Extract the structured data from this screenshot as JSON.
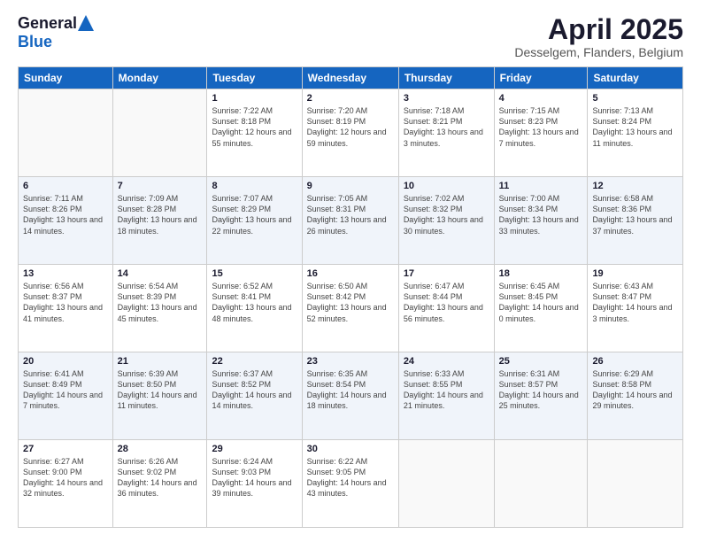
{
  "logo": {
    "general": "General",
    "blue": "Blue"
  },
  "header": {
    "month_year": "April 2025",
    "location": "Desselgem, Flanders, Belgium"
  },
  "weekdays": [
    "Sunday",
    "Monday",
    "Tuesday",
    "Wednesday",
    "Thursday",
    "Friday",
    "Saturday"
  ],
  "weeks": [
    [
      {
        "day": "",
        "info": ""
      },
      {
        "day": "",
        "info": ""
      },
      {
        "day": "1",
        "info": "Sunrise: 7:22 AM\nSunset: 8:18 PM\nDaylight: 12 hours and 55 minutes."
      },
      {
        "day": "2",
        "info": "Sunrise: 7:20 AM\nSunset: 8:19 PM\nDaylight: 12 hours and 59 minutes."
      },
      {
        "day": "3",
        "info": "Sunrise: 7:18 AM\nSunset: 8:21 PM\nDaylight: 13 hours and 3 minutes."
      },
      {
        "day": "4",
        "info": "Sunrise: 7:15 AM\nSunset: 8:23 PM\nDaylight: 13 hours and 7 minutes."
      },
      {
        "day": "5",
        "info": "Sunrise: 7:13 AM\nSunset: 8:24 PM\nDaylight: 13 hours and 11 minutes."
      }
    ],
    [
      {
        "day": "6",
        "info": "Sunrise: 7:11 AM\nSunset: 8:26 PM\nDaylight: 13 hours and 14 minutes."
      },
      {
        "day": "7",
        "info": "Sunrise: 7:09 AM\nSunset: 8:28 PM\nDaylight: 13 hours and 18 minutes."
      },
      {
        "day": "8",
        "info": "Sunrise: 7:07 AM\nSunset: 8:29 PM\nDaylight: 13 hours and 22 minutes."
      },
      {
        "day": "9",
        "info": "Sunrise: 7:05 AM\nSunset: 8:31 PM\nDaylight: 13 hours and 26 minutes."
      },
      {
        "day": "10",
        "info": "Sunrise: 7:02 AM\nSunset: 8:32 PM\nDaylight: 13 hours and 30 minutes."
      },
      {
        "day": "11",
        "info": "Sunrise: 7:00 AM\nSunset: 8:34 PM\nDaylight: 13 hours and 33 minutes."
      },
      {
        "day": "12",
        "info": "Sunrise: 6:58 AM\nSunset: 8:36 PM\nDaylight: 13 hours and 37 minutes."
      }
    ],
    [
      {
        "day": "13",
        "info": "Sunrise: 6:56 AM\nSunset: 8:37 PM\nDaylight: 13 hours and 41 minutes."
      },
      {
        "day": "14",
        "info": "Sunrise: 6:54 AM\nSunset: 8:39 PM\nDaylight: 13 hours and 45 minutes."
      },
      {
        "day": "15",
        "info": "Sunrise: 6:52 AM\nSunset: 8:41 PM\nDaylight: 13 hours and 48 minutes."
      },
      {
        "day": "16",
        "info": "Sunrise: 6:50 AM\nSunset: 8:42 PM\nDaylight: 13 hours and 52 minutes."
      },
      {
        "day": "17",
        "info": "Sunrise: 6:47 AM\nSunset: 8:44 PM\nDaylight: 13 hours and 56 minutes."
      },
      {
        "day": "18",
        "info": "Sunrise: 6:45 AM\nSunset: 8:45 PM\nDaylight: 14 hours and 0 minutes."
      },
      {
        "day": "19",
        "info": "Sunrise: 6:43 AM\nSunset: 8:47 PM\nDaylight: 14 hours and 3 minutes."
      }
    ],
    [
      {
        "day": "20",
        "info": "Sunrise: 6:41 AM\nSunset: 8:49 PM\nDaylight: 14 hours and 7 minutes."
      },
      {
        "day": "21",
        "info": "Sunrise: 6:39 AM\nSunset: 8:50 PM\nDaylight: 14 hours and 11 minutes."
      },
      {
        "day": "22",
        "info": "Sunrise: 6:37 AM\nSunset: 8:52 PM\nDaylight: 14 hours and 14 minutes."
      },
      {
        "day": "23",
        "info": "Sunrise: 6:35 AM\nSunset: 8:54 PM\nDaylight: 14 hours and 18 minutes."
      },
      {
        "day": "24",
        "info": "Sunrise: 6:33 AM\nSunset: 8:55 PM\nDaylight: 14 hours and 21 minutes."
      },
      {
        "day": "25",
        "info": "Sunrise: 6:31 AM\nSunset: 8:57 PM\nDaylight: 14 hours and 25 minutes."
      },
      {
        "day": "26",
        "info": "Sunrise: 6:29 AM\nSunset: 8:58 PM\nDaylight: 14 hours and 29 minutes."
      }
    ],
    [
      {
        "day": "27",
        "info": "Sunrise: 6:27 AM\nSunset: 9:00 PM\nDaylight: 14 hours and 32 minutes."
      },
      {
        "day": "28",
        "info": "Sunrise: 6:26 AM\nSunset: 9:02 PM\nDaylight: 14 hours and 36 minutes."
      },
      {
        "day": "29",
        "info": "Sunrise: 6:24 AM\nSunset: 9:03 PM\nDaylight: 14 hours and 39 minutes."
      },
      {
        "day": "30",
        "info": "Sunrise: 6:22 AM\nSunset: 9:05 PM\nDaylight: 14 hours and 43 minutes."
      },
      {
        "day": "",
        "info": ""
      },
      {
        "day": "",
        "info": ""
      },
      {
        "day": "",
        "info": ""
      }
    ]
  ]
}
